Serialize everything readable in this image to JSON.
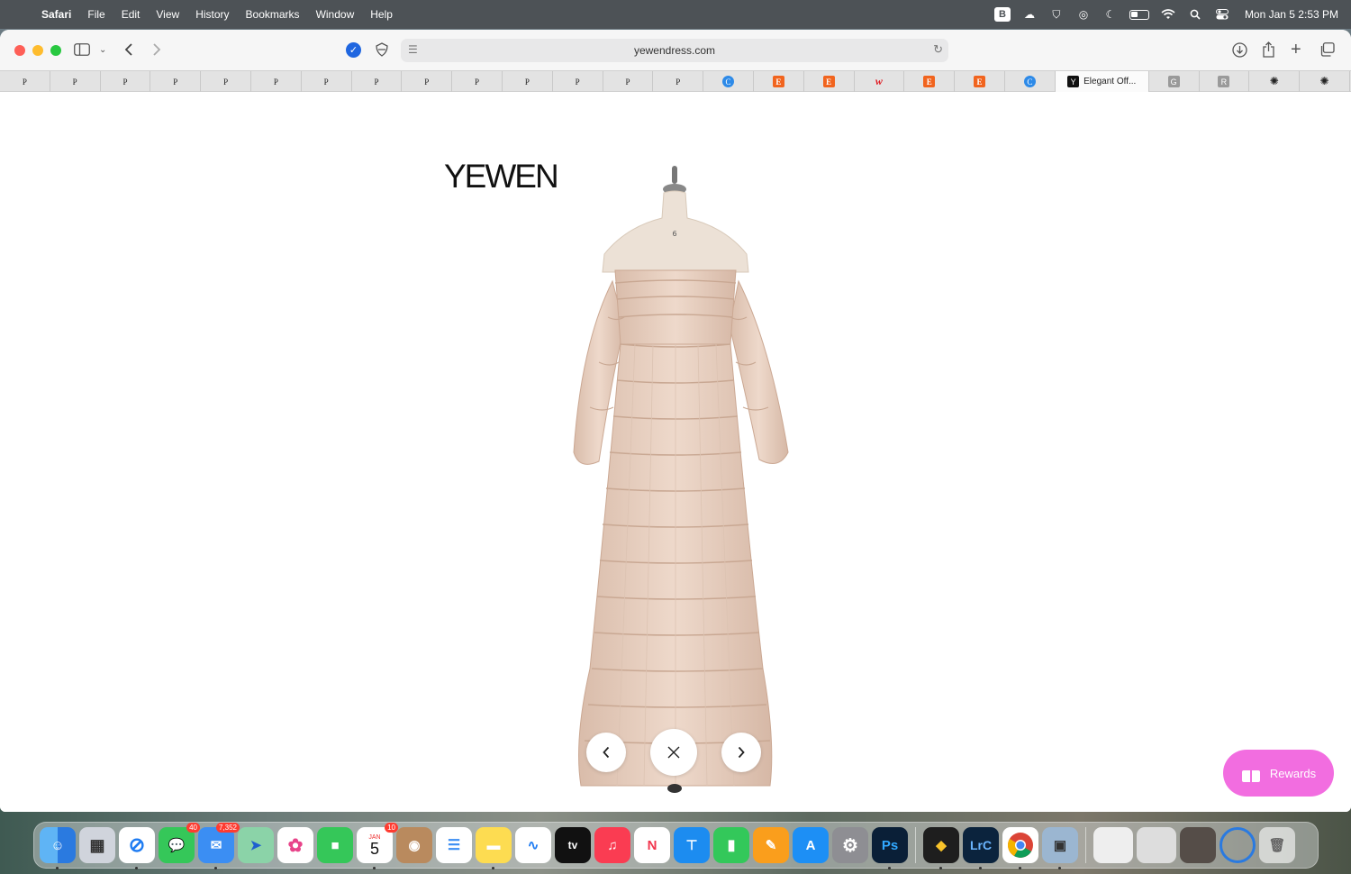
{
  "menubar": {
    "app_name": "Safari",
    "items": [
      "File",
      "Edit",
      "View",
      "History",
      "Bookmarks",
      "Window",
      "Help"
    ],
    "clock": "Mon Jan 5  2:53 PM",
    "status_icons": [
      "bbedit-icon",
      "cloud-icon",
      "shield-icon",
      "airdrop-icon",
      "moon-icon",
      "battery-icon",
      "wifi-icon",
      "search-icon",
      "control-center-icon"
    ]
  },
  "toolbar": {
    "url": "yewendress.com"
  },
  "tabs": [
    {
      "label": "P",
      "icon": "p"
    },
    {
      "label": "P",
      "icon": "p"
    },
    {
      "label": "P",
      "icon": "p"
    },
    {
      "label": "P",
      "icon": "p"
    },
    {
      "label": "P",
      "icon": "p"
    },
    {
      "label": "P",
      "icon": "p"
    },
    {
      "label": "P",
      "icon": "p"
    },
    {
      "label": "P",
      "icon": "p"
    },
    {
      "label": "P",
      "icon": "p"
    },
    {
      "label": "P",
      "icon": "p"
    },
    {
      "label": "P",
      "icon": "p"
    },
    {
      "label": "P",
      "icon": "p"
    },
    {
      "label": "P",
      "icon": "p"
    },
    {
      "label": "P",
      "icon": "p"
    },
    {
      "label": "C",
      "icon": "c"
    },
    {
      "label": "E",
      "icon": "e"
    },
    {
      "label": "E",
      "icon": "e"
    },
    {
      "label": "w",
      "icon": "w"
    },
    {
      "label": "E",
      "icon": "e"
    },
    {
      "label": "E",
      "icon": "e"
    },
    {
      "label": "C",
      "icon": "c"
    },
    {
      "label": "Elegant Off...",
      "icon": "y",
      "active": true
    },
    {
      "label": "G",
      "icon": "g"
    },
    {
      "label": "R",
      "icon": "g"
    },
    {
      "label": "✺",
      "icon": "o"
    },
    {
      "label": "✺",
      "icon": "o"
    }
  ],
  "page": {
    "logo": "YEWEN",
    "mannequin_tag": "6",
    "prev_label": "‹",
    "close_label": "✕",
    "next_label": "›",
    "rewards_label": "Rewards"
  },
  "dock": {
    "badges": {
      "messages": "40",
      "mail": "7,352",
      "calendar": "10"
    },
    "calendar_month": "JAN",
    "calendar_day": "5",
    "appletv_label": "tv",
    "ps_label": "Ps",
    "lrc_label": "LrC"
  },
  "colors": {
    "accent_pink": "#f26de0",
    "dress": "#e8cfc0",
    "menubar": "#4d5256"
  }
}
